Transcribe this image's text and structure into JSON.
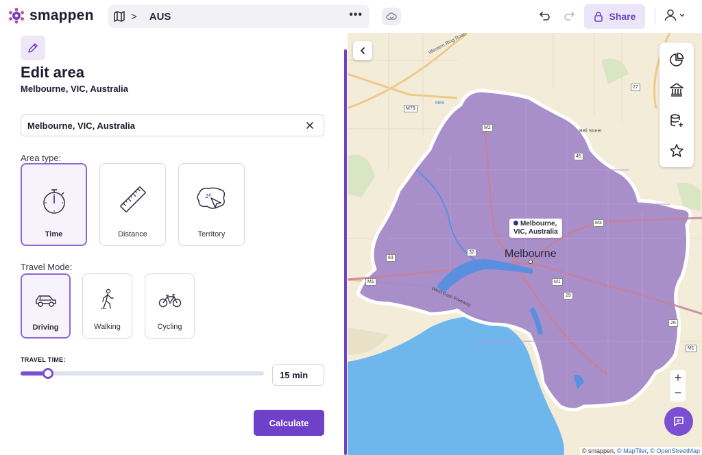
{
  "header": {
    "logo_text": "smappen",
    "breadcrumb_text": "AUS",
    "breadcrumb_separator": ">",
    "more_label": "•••",
    "share_label": "Share"
  },
  "panel": {
    "title": "Edit area",
    "subtitle": "Melbourne, VIC, Australia",
    "search_value": "Melbourne, VIC, Australia",
    "area_type_label": "Area type:",
    "area_types": [
      {
        "label": "Time",
        "icon": "stopwatch-icon",
        "selected": true
      },
      {
        "label": "Distance",
        "icon": "ruler-icon",
        "selected": false
      },
      {
        "label": "Territory",
        "icon": "territory-icon",
        "selected": false
      }
    ],
    "travel_mode_label": "Travel Mode:",
    "travel_modes": [
      {
        "label": "Driving",
        "icon": "car-icon",
        "selected": true
      },
      {
        "label": "Walking",
        "icon": "walking-icon",
        "selected": false
      },
      {
        "label": "Cycling",
        "icon": "bicycle-icon",
        "selected": false
      }
    ],
    "travel_time_label": "TRAVEL TIME:",
    "travel_time_value": "15 min",
    "slider_fraction": 0.09,
    "calculate_label": "Calculate"
  },
  "map": {
    "pin_label_line1": "Melbourne,",
    "pin_label_line2": "VIC, Australia",
    "city_label": "Melbourne",
    "zoom_in": "+",
    "zoom_out": "−",
    "attribution_prefix": "© smappen, ",
    "attribution_maptiler": "© MapTiler",
    "attribution_sep": ", ",
    "attribution_osm": "© OpenStreetMap",
    "road_shields": [
      "M79",
      "M2",
      "27",
      "45",
      "M3",
      "M1",
      "83",
      "32",
      "M1",
      "29",
      "26",
      "M1"
    ],
    "place_labels": [
      "Western Ring Road",
      "MEB",
      "Bell Street",
      "West Gate Freeway"
    ]
  },
  "colors": {
    "brand": "#6f40c8",
    "isochrone_fill": "#9b7ec8",
    "water": "#6fb6ec",
    "land": "#f2ecd9"
  }
}
